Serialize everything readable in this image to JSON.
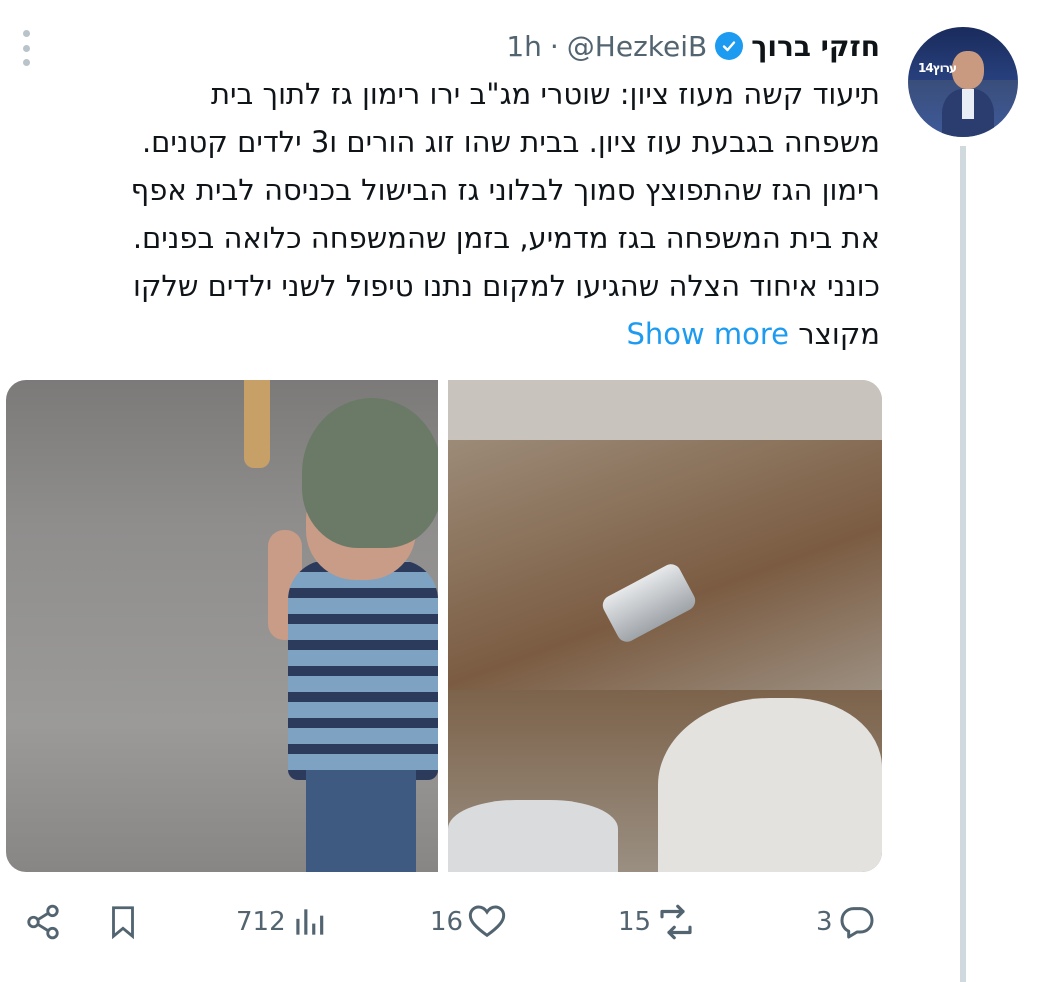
{
  "tweet": {
    "author_name": "חזקי ברוך",
    "handle": "@HezkeiB",
    "separator": "·",
    "time": "1h",
    "lines": [
      "תיעוד קשה מעוז ציון: שוטרי מג\"ב ירו רימון גז לתוך בית",
      "משפחה בגבעת עוז ציון. בבית שהו זוג הורים ו3 ילדים קטנים.",
      "רימון הגז שהתפוצץ סמוך לבלוני גז הבישול בכניסה לבית אפף",
      "את בית המשפחה בגז מדמיע, בזמן שהמשפחה כלואה בפנים.",
      "כונני איחוד הצלה שהגיעו למקום נתנו טיפול לשני ילדים שלקו"
    ],
    "last_line_text": "מקוצר",
    "show_more": "Show more",
    "avatar_overlay": "ערוץ14"
  },
  "actions": {
    "replies": "3",
    "reposts": "15",
    "likes": "16",
    "views": "712"
  },
  "icons": {
    "more": "more-vertical-icon",
    "verified": "verified-badge-icon",
    "reply": "reply-icon",
    "repost": "repost-icon",
    "like": "heart-icon",
    "views": "views-chart-icon",
    "bookmark": "bookmark-icon",
    "share": "share-icon"
  },
  "colors": {
    "accent": "#1d9bf0",
    "secondary_text": "#536471",
    "thread_line": "#cfd9de"
  }
}
